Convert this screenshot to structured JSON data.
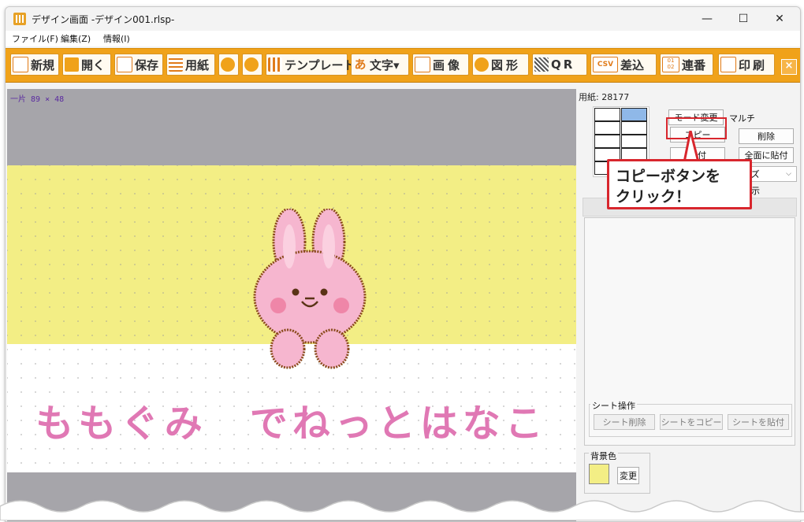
{
  "window": {
    "title": "デザイン画面 -デザイン001.rlsp-",
    "controls": {
      "minimize": "—",
      "maximize": "☐",
      "close": "✕"
    }
  },
  "menu": [
    "ファイル(F)",
    "編集(Z)",
    "情報(I)"
  ],
  "toolbar": {
    "buttons": [
      {
        "label": "新規",
        "icon": "new-file-icon"
      },
      {
        "label": "開く",
        "icon": "folder-open-icon"
      },
      {
        "label": "保存",
        "icon": "save-icon"
      },
      {
        "label": "用紙",
        "icon": "paper-icon"
      },
      {
        "label": "",
        "icon": "undo-icon"
      },
      {
        "label": "",
        "icon": "redo-icon"
      },
      {
        "label": "テンプレート",
        "icon": "template-icon"
      },
      {
        "label": "文字▾",
        "icon": "text-icon",
        "icon_text": "あ"
      },
      {
        "label": "画像",
        "icon": "image-icon"
      },
      {
        "label": "図形",
        "icon": "shape-icon"
      },
      {
        "label": "QR",
        "icon": "qr-icon"
      },
      {
        "label": "差込",
        "icon": "csv-icon",
        "icon_text": "CSV"
      },
      {
        "label": "連番",
        "icon": "serial-number-icon",
        "icon_text": "01 02"
      },
      {
        "label": "印刷",
        "icon": "print-icon"
      }
    ],
    "close": "×"
  },
  "canvas": {
    "size_label": "一片 89 × 48",
    "text": "ももぐみ　でねっとはなこ",
    "band_color": "#f3ee85",
    "text_color": "#e078b4",
    "image": "bunny-illustration"
  },
  "panel": {
    "paper_label": "用紙: 28177",
    "buttons": {
      "mode_change": "モード変更",
      "multi": "マルチ",
      "copy": "コピー",
      "delete": "削除",
      "paste": "貼付",
      "paste_all": "全面に貼付",
      "size_select": "イズ",
      "trailing_char": "示"
    },
    "sheet_ops": {
      "title": "シート操作",
      "delete": "シート削除",
      "copy": "シートをコピー",
      "paste": "シートを貼付"
    },
    "background": {
      "title": "背景色",
      "change": "変更",
      "color": "#f3ee85"
    }
  },
  "callout": {
    "text": "コピーボタンを\nクリック！"
  }
}
